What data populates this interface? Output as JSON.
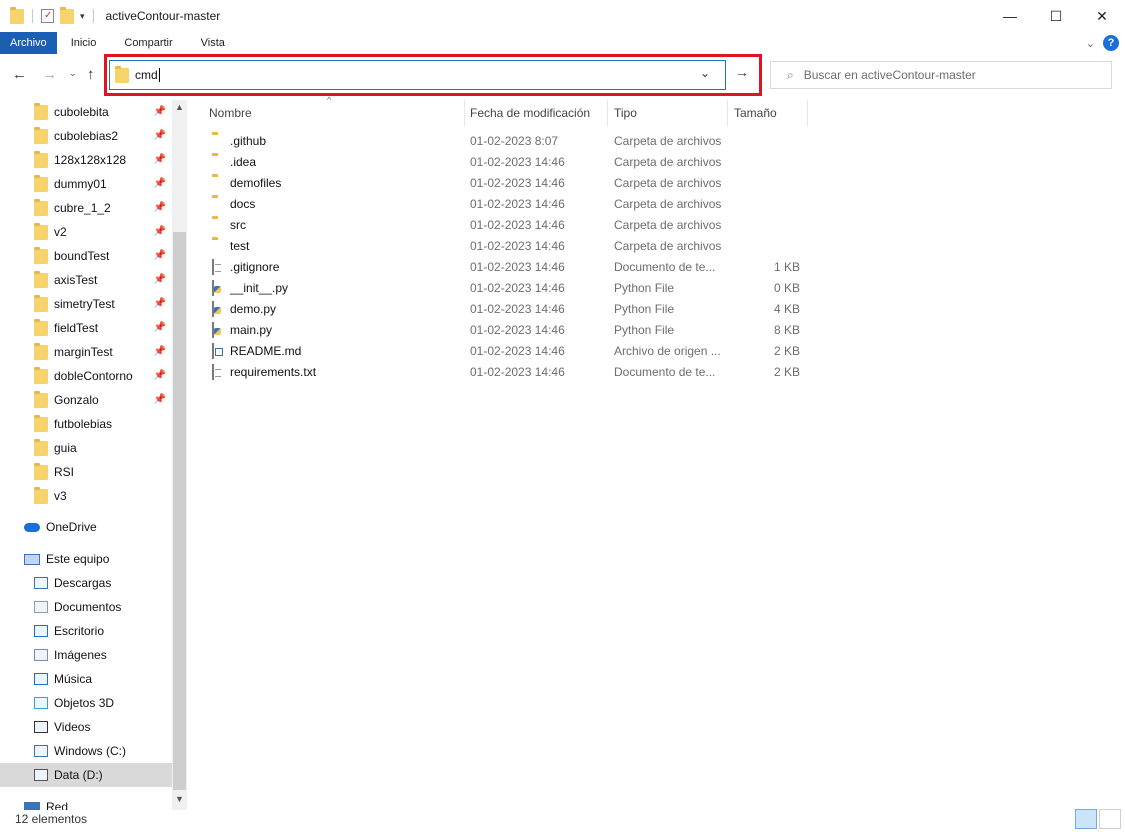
{
  "window": {
    "title": "activeContour-master",
    "controls": {
      "minimize": "—",
      "maximize": "☐",
      "close": "✕"
    }
  },
  "ribbon": {
    "tabs": [
      {
        "label": "Archivo"
      },
      {
        "label": "Inicio"
      },
      {
        "label": "Compartir"
      },
      {
        "label": "Vista"
      }
    ],
    "help": "?"
  },
  "address": {
    "value": "cmd"
  },
  "search": {
    "placeholder": "Buscar en activeContour-master"
  },
  "navpane": {
    "quick_access": [
      {
        "label": "cubolebita",
        "pinned": true
      },
      {
        "label": "cubolebias2",
        "pinned": true
      },
      {
        "label": "128x128x128",
        "pinned": true
      },
      {
        "label": "dummy01",
        "pinned": true
      },
      {
        "label": "cubre_1_2",
        "pinned": true
      },
      {
        "label": "v2",
        "pinned": true
      },
      {
        "label": "boundTest",
        "pinned": true
      },
      {
        "label": "axisTest",
        "pinned": true
      },
      {
        "label": "simetryTest",
        "pinned": true
      },
      {
        "label": "fieldTest",
        "pinned": true
      },
      {
        "label": "marginTest",
        "pinned": true
      },
      {
        "label": "dobleContorno",
        "pinned": true
      },
      {
        "label": "Gonzalo",
        "pinned": true
      },
      {
        "label": "futbolebias",
        "pinned": false
      },
      {
        "label": "guia",
        "pinned": false
      },
      {
        "label": "RSI",
        "pinned": false
      },
      {
        "label": "v3",
        "pinned": false
      }
    ],
    "onedrive": "OneDrive",
    "this_pc": "Este equipo",
    "pc_items": [
      {
        "label": "Descargas",
        "icon": "download-icon"
      },
      {
        "label": "Documentos",
        "icon": "documents-icon"
      },
      {
        "label": "Escritorio",
        "icon": "desktop-icon"
      },
      {
        "label": "Imágenes",
        "icon": "pictures-icon"
      },
      {
        "label": "Música",
        "icon": "music-icon"
      },
      {
        "label": "Objetos 3D",
        "icon": "3d-objects-icon"
      },
      {
        "label": "Videos",
        "icon": "videos-icon"
      },
      {
        "label": "Windows (C:)",
        "icon": "drive-c-icon"
      },
      {
        "label": "Data (D:)",
        "icon": "drive-d-icon",
        "selected": true
      }
    ],
    "network": "Red"
  },
  "columns": {
    "name": "Nombre",
    "date": "Fecha de modificación",
    "type": "Tipo",
    "size": "Tamaño"
  },
  "files": [
    {
      "name": ".github",
      "date": "01-02-2023 8:07",
      "type": "Carpeta de archivos",
      "size": "",
      "kind": "folder"
    },
    {
      "name": ".idea",
      "date": "01-02-2023 14:46",
      "type": "Carpeta de archivos",
      "size": "",
      "kind": "folder"
    },
    {
      "name": "demofiles",
      "date": "01-02-2023 14:46",
      "type": "Carpeta de archivos",
      "size": "",
      "kind": "folder"
    },
    {
      "name": "docs",
      "date": "01-02-2023 14:46",
      "type": "Carpeta de archivos",
      "size": "",
      "kind": "folder"
    },
    {
      "name": "src",
      "date": "01-02-2023 14:46",
      "type": "Carpeta de archivos",
      "size": "",
      "kind": "folder"
    },
    {
      "name": "test",
      "date": "01-02-2023 14:46",
      "type": "Carpeta de archivos",
      "size": "",
      "kind": "folder"
    },
    {
      "name": ".gitignore",
      "date": "01-02-2023 14:46",
      "type": "Documento de te...",
      "size": "1 KB",
      "kind": "doc"
    },
    {
      "name": "__init__.py",
      "date": "01-02-2023 14:46",
      "type": "Python File",
      "size": "0 KB",
      "kind": "py"
    },
    {
      "name": "demo.py",
      "date": "01-02-2023 14:46",
      "type": "Python File",
      "size": "4 KB",
      "kind": "py"
    },
    {
      "name": "main.py",
      "date": "01-02-2023 14:46",
      "type": "Python File",
      "size": "8 KB",
      "kind": "py"
    },
    {
      "name": "README.md",
      "date": "01-02-2023 14:46",
      "type": "Archivo de origen ...",
      "size": "2 KB",
      "kind": "md"
    },
    {
      "name": "requirements.txt",
      "date": "01-02-2023 14:46",
      "type": "Documento de te...",
      "size": "2 KB",
      "kind": "doc"
    }
  ],
  "status": {
    "count": "12 elementos"
  }
}
